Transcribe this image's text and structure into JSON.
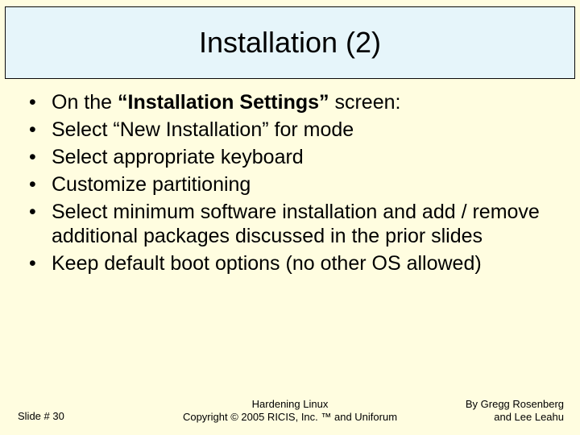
{
  "title": "Installation (2)",
  "bullets": {
    "b1_pre": "On the ",
    "b1_strong": "“Installation Settings”",
    "b1_post": " screen:",
    "b2": "Select “New Installation” for mode",
    "b3": "Select appropriate keyboard",
    "b4": "Customize partitioning",
    "b5": "Select minimum software installation and add / remove additional packages discussed in the prior slides",
    "b6": "Keep default boot options (no other OS allowed)"
  },
  "footer": {
    "slide_number": "Slide # 30",
    "center_line1": "Hardening Linux",
    "center_line2": "Copyright © 2005 RICIS, Inc. ™ and Uniforum",
    "right_line1": "By Gregg Rosenberg",
    "right_line2": "and Lee Leahu"
  }
}
